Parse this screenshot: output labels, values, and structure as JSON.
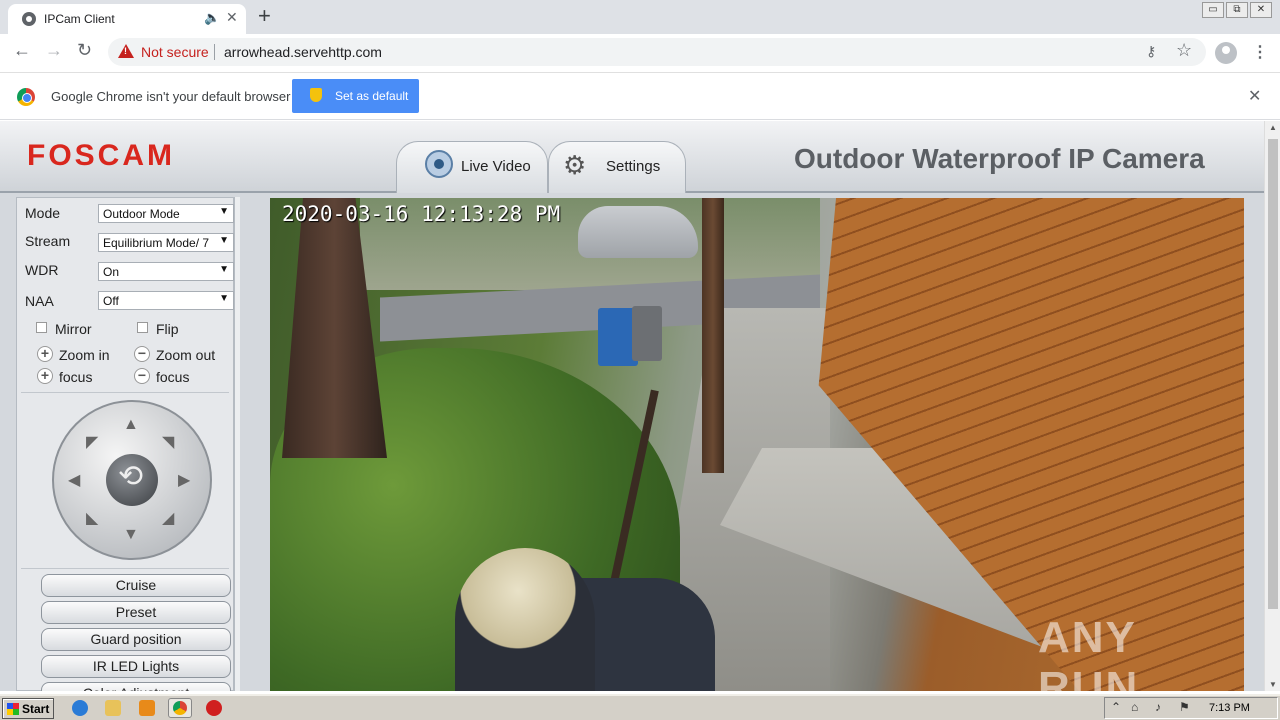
{
  "browser": {
    "tab_title": "IPCam Client",
    "audio_icon": "speaker-icon",
    "close_glyph": "✕",
    "new_tab_glyph": "+",
    "security_label": "Not secure",
    "url": "arrowhead.servehttp.com",
    "back_glyph": "←",
    "forward_glyph": "→",
    "reload_glyph": "↻",
    "key_glyph": "⚷",
    "star_glyph": "☆",
    "menu_glyph": "⋮",
    "window_buttons": [
      "▭",
      "⧉",
      "✕"
    ]
  },
  "infobar": {
    "message": "Google Chrome isn't your default browser",
    "button_label": "Set as default",
    "close_glyph": "✕"
  },
  "camera_ui": {
    "logo": "FOSCAM",
    "tabs": [
      {
        "label": "Live Video",
        "icon": "camera-icon",
        "active": true
      },
      {
        "label": "Settings",
        "icon": "gear-icon",
        "active": false
      }
    ],
    "product_title": "Outdoor Waterproof IP Camera",
    "controls": {
      "mode_label": "Mode",
      "mode_value": "Outdoor Mode",
      "stream_label": "Stream",
      "stream_value": "Equilibrium Mode/ 7",
      "wdr_label": "WDR",
      "wdr_value": "On",
      "naa_label": "NAA",
      "naa_value": "Off",
      "mirror_label": "Mirror",
      "flip_label": "Flip",
      "zoom_in_label": "Zoom in",
      "zoom_out_label": "Zoom out",
      "focus_plus_label": "focus",
      "focus_minus_label": "focus",
      "plus_glyph": "+",
      "minus_glyph": "−",
      "select_arrow": "▼"
    },
    "ptz": {
      "up": "▲",
      "down": "▼",
      "left": "◀",
      "right": "▶",
      "upleft": "◤",
      "upright": "◥",
      "downleft": "◣",
      "downright": "◢"
    },
    "buttons": [
      "Cruise",
      "Preset",
      "Guard position",
      "IR LED Lights",
      "Color Adjustment"
    ],
    "video": {
      "timestamp": "2020-03-16 12:13:28 PM",
      "watermark": "ANY RUN"
    }
  },
  "taskbar": {
    "start_label": "Start",
    "clock": "7:13 PM",
    "tray_icons": [
      "⌃",
      "⌂",
      "♪",
      "⚑"
    ]
  },
  "colors": {
    "brand_red": "#d9271e",
    "infobar_button": "#4a8df7",
    "not_secure": "#c5221f"
  }
}
